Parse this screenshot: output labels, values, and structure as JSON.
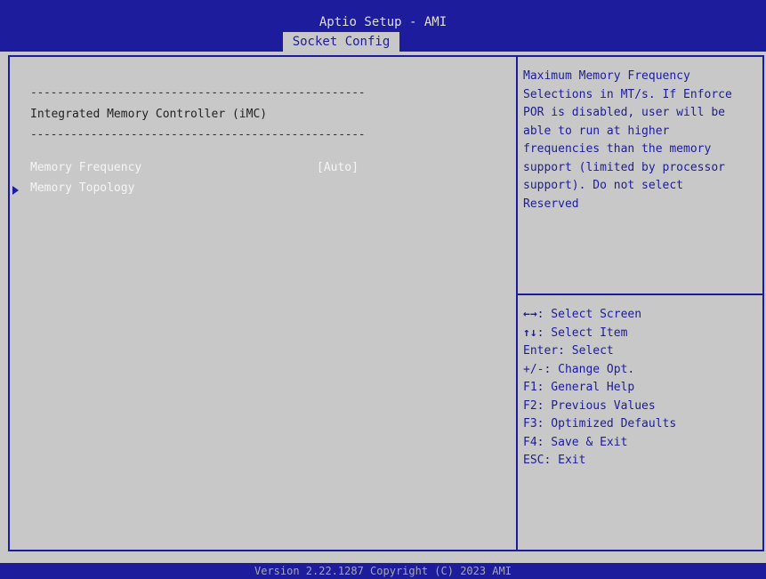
{
  "header": {
    "title": "Aptio Setup - AMI",
    "tab": "Socket Config"
  },
  "main": {
    "dash_top": "--------------------------------------------------",
    "section_title": "Integrated Memory Controller (iMC)",
    "dash_bottom": "--------------------------------------------------",
    "items": [
      {
        "label": "Memory Frequency",
        "value": "[Auto]"
      },
      {
        "label": "Memory Topology",
        "submenu_icon": "triangle-right-icon"
      }
    ]
  },
  "help": {
    "lines": [
      "Maximum Memory Frequency",
      "Selections in MT/s. If Enforce",
      "POR is disabled, user will be",
      "able to run at higher",
      "frequencies than the memory",
      "support (limited by processor",
      "support). Do not select",
      "Reserved"
    ]
  },
  "keys": [
    {
      "key": "←→",
      "desc": ": Select Screen"
    },
    {
      "key": "↑↓",
      "desc": ": Select Item"
    },
    {
      "key": "",
      "desc": "Enter: Select"
    },
    {
      "key": "",
      "desc": "+/-: Change Opt."
    },
    {
      "key": "",
      "desc": "F1: General Help"
    },
    {
      "key": "",
      "desc": "F2: Previous Values"
    },
    {
      "key": "",
      "desc": "F3: Optimized Defaults"
    },
    {
      "key": "",
      "desc": "F4: Save & Exit"
    },
    {
      "key": "",
      "desc": "ESC: Exit"
    }
  ],
  "footer": {
    "text": "Version 2.22.1287 Copyright (C) 2023 AMI"
  },
  "colors": {
    "bios_blue": "#1c1c9c",
    "panel_gray": "#c8c8c8",
    "highlight_white": "#f5f5f5"
  }
}
